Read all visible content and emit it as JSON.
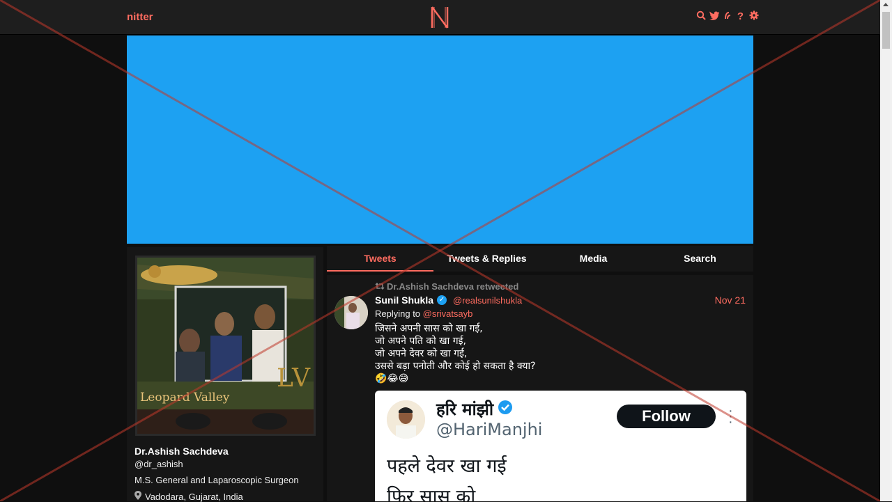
{
  "navbar": {
    "brand": "nitter",
    "icons": [
      "search-icon",
      "twitter-icon",
      "rss-icon",
      "help-icon",
      "settings-icon"
    ]
  },
  "colors": {
    "accent": "#ff6c60",
    "banner": "#1da1f2",
    "background": "#0f0f0f",
    "panel": "#161616"
  },
  "profile": {
    "name": "Dr.Ashish Sachdeva",
    "handle": "@dr_ashish",
    "bio": "M.S. General and Laparoscopic Surgeon",
    "location": "Vadodara, Gujarat, India",
    "photo_caption": "Leopard Valley"
  },
  "tabs": [
    {
      "label": "Tweets",
      "active": true
    },
    {
      "label": "Tweets & Replies",
      "active": false
    },
    {
      "label": "Media",
      "active": false
    },
    {
      "label": "Search",
      "active": false
    }
  ],
  "tweet": {
    "retweet_header": "Dr.Ashish Sachdeva retweeted",
    "name": "Sunil Shukla",
    "handle": "@realsunilshukla",
    "date": "Nov 21",
    "replying_prefix": "Replying to",
    "replying_to": "@srivatsayb",
    "lines": [
      "जिसने अपनी सास को खा गई,",
      "जो अपने पति को खा गई,",
      "जो अपने देवर को खा गई,",
      "उससे बड़ा पनोती और कोई हो सकता है क्या?",
      "🤣😂😅"
    ],
    "embedded": {
      "name": "हरि मांझी",
      "handle": "@HariManjhi",
      "follow_label": "Follow",
      "line1": "पहले देवर खा गई",
      "line2": "फिर सास को"
    }
  }
}
